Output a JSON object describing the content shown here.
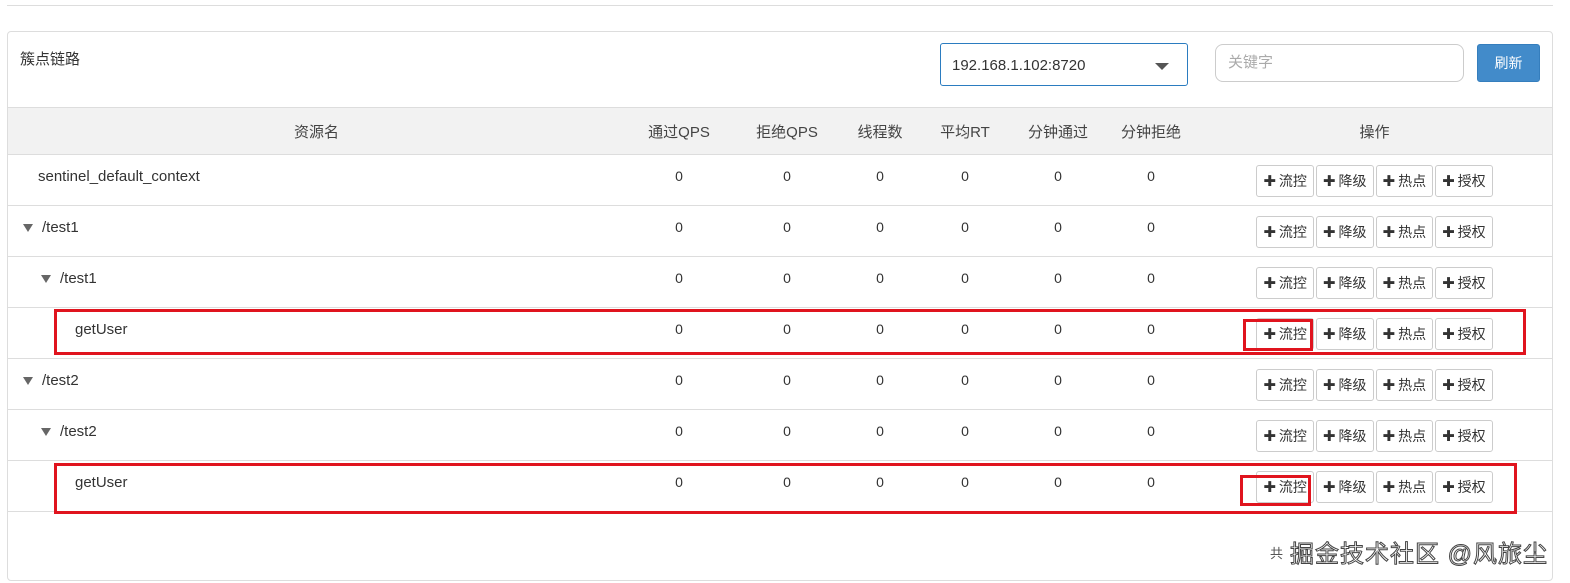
{
  "title": "簇点链路",
  "machine_select": "192.168.1.102:8720",
  "search_placeholder": "关键字",
  "refresh_label": "刷新",
  "columns": [
    "资源名",
    "通过QPS",
    "拒绝QPS",
    "线程数",
    "平均RT",
    "分钟通过",
    "分钟拒绝",
    "操作"
  ],
  "actions": [
    "流控",
    "降级",
    "热点",
    "授权"
  ],
  "rows": [
    {
      "name": "sentinel_default_context",
      "level": 0,
      "expand": false,
      "values": [
        "0",
        "0",
        "0",
        "0",
        "0",
        "0"
      ]
    },
    {
      "name": "/test1",
      "level": 0,
      "expand": true,
      "values": [
        "0",
        "0",
        "0",
        "0",
        "0",
        "0"
      ]
    },
    {
      "name": "/test1",
      "level": 1,
      "expand": true,
      "values": [
        "0",
        "0",
        "0",
        "0",
        "0",
        "0"
      ]
    },
    {
      "name": "getUser",
      "level": 2,
      "expand": false,
      "values": [
        "0",
        "0",
        "0",
        "0",
        "0",
        "0"
      ]
    },
    {
      "name": "/test2",
      "level": 0,
      "expand": true,
      "values": [
        "0",
        "0",
        "0",
        "0",
        "0",
        "0"
      ]
    },
    {
      "name": "/test2",
      "level": 1,
      "expand": true,
      "values": [
        "0",
        "0",
        "0",
        "0",
        "0",
        "0"
      ]
    },
    {
      "name": "getUser",
      "level": 2,
      "expand": false,
      "values": [
        "0",
        "0",
        "0",
        "0",
        "0",
        "0"
      ]
    }
  ],
  "footer": "共",
  "watermark": "掘金技术社区 @风旅尘",
  "highlight_color": "#e0141e"
}
